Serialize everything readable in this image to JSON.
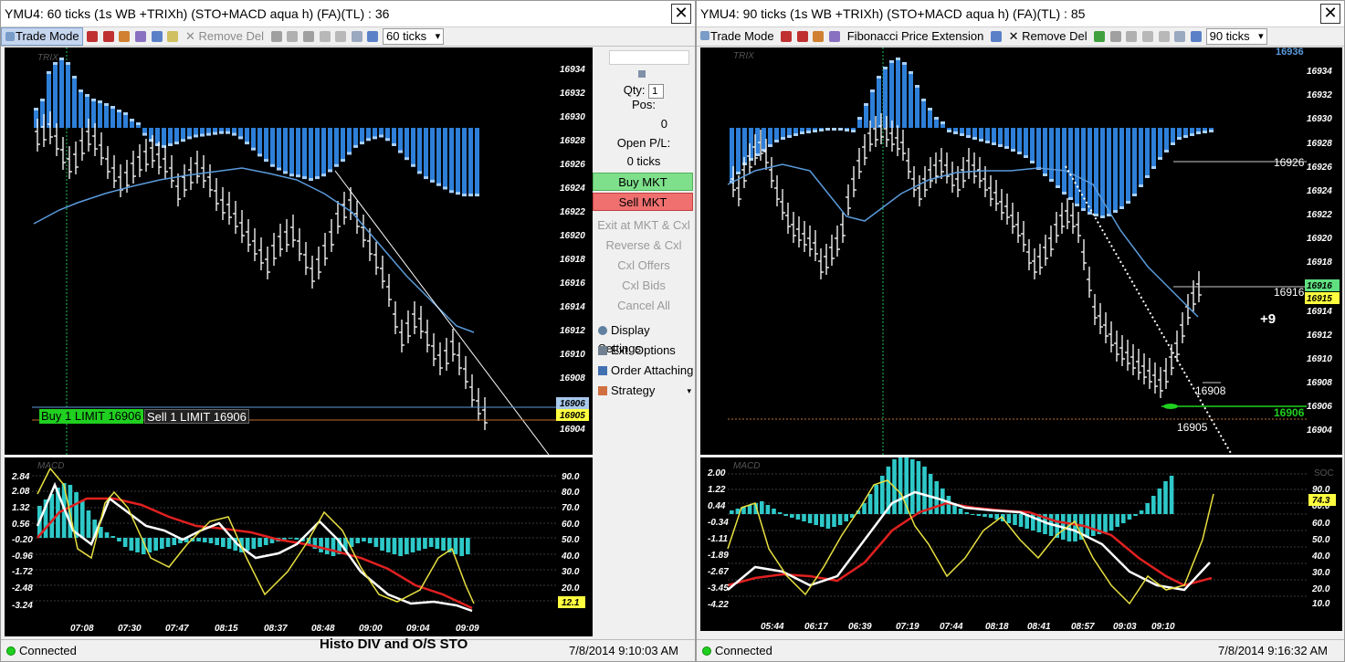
{
  "left_window": {
    "title": "YMU4: 60 ticks (1s WB +TRIXh) (STO+MACD aqua h) (FA)(TL) : 36",
    "close": "✕",
    "toolbar": {
      "trade_mode": "Trade Mode",
      "remove_del": "Remove Del",
      "interval": "60 ticks"
    },
    "price_chart": {
      "label": "TRIX",
      "axis": [
        "16934",
        "16932",
        "16930",
        "16928",
        "16926",
        "16924",
        "16922",
        "16920",
        "16918",
        "16916",
        "16914",
        "16912",
        "16910",
        "16908",
        "16906",
        "16905",
        "16904"
      ],
      "buy_order": "Buy 1 LIMIT 16906",
      "sell_order": "Sell 1 LIMIT 16906"
    },
    "macd_chart": {
      "label": "MACD",
      "left_axis": [
        "2.84",
        "2.08",
        "1.32",
        "0.56",
        "-0.20",
        "-0.96",
        "-1.72",
        "-2.48",
        "-3.24"
      ],
      "right_axis": [
        "90.0",
        "80.0",
        "70.0",
        "60.0",
        "50.0",
        "40.0",
        "30.0",
        "20.0",
        "12.1"
      ],
      "times": [
        "07:08",
        "07:30",
        "07:47",
        "08:15",
        "08:37",
        "08:48",
        "09:00",
        "09:04",
        "09:09"
      ]
    },
    "status": {
      "connected": "Connected",
      "time": "7/8/2014 9:10:03 AM"
    }
  },
  "order_panel": {
    "qty_label": "Qty:",
    "qty_value": "1",
    "pos_label": "Pos:",
    "pos_value": "0",
    "open_pl_label": "Open P/L:",
    "open_pl_value": "0 ticks",
    "buy_mkt": "Buy MKT",
    "sell_mkt": "Sell MKT",
    "exit": "Exit at MKT & Cxl",
    "reverse": "Reverse & Cxl",
    "cxl_offers": "Cxl Offers",
    "cxl_bids": "Cxl Bids",
    "cancel_all": "Cancel All",
    "display_settings": "Display Settings",
    "ext_options": "Ext. Options",
    "order_attaching": "Order Attaching",
    "strategy": "Strategy"
  },
  "caption": "Histo DIV and O/S STO",
  "right_window": {
    "title": "YMU4: 90 ticks (1s WB +TRIXh) (STO+MACD aqua h) (FA)(TL) : 85",
    "close": "✕",
    "toolbar": {
      "trade_mode": "Trade Mode",
      "fib": "Fibonacci Price Extension",
      "remove_del": "Remove Del",
      "interval": "90 ticks"
    },
    "price_chart": {
      "label": "TRIX",
      "axis": [
        "16936",
        "16934",
        "16932",
        "16930",
        "16928",
        "16926",
        "16924",
        "16922",
        "16920",
        "16918",
        "16916",
        "16915",
        "16914",
        "16912",
        "16910",
        "16908",
        "16906",
        "16904"
      ],
      "annotations": {
        "level_16926": "16926",
        "level_16916": "16916",
        "level_16906": "16906",
        "low_16908": "16908",
        "low_16905": "16905",
        "gain": "+9"
      }
    },
    "macd_chart": {
      "label": "MACD",
      "left_axis": [
        "2.00",
        "1.22",
        "0.44",
        "-0.34",
        "-1.11",
        "-1.89",
        "-2.67",
        "-3.45",
        "-4.22"
      ],
      "right_axis": [
        "90.0",
        "80.0",
        "74.3",
        "60.0",
        "50.0",
        "40.0",
        "30.0",
        "20.0",
        "10.0"
      ],
      "right_axis_top": "SOC",
      "times": [
        "05:44",
        "06:17",
        "06:39",
        "07:19",
        "07:44",
        "08:18",
        "08:41",
        "08:57",
        "09:03",
        "09:10"
      ]
    },
    "status": {
      "connected": "Connected",
      "time": "7/8/2014 9:16:32 AM"
    }
  },
  "colors": {
    "histogram": "#2e7fd8",
    "macd_histogram": "#2ec8c8",
    "trix_line": "#5a9bdc",
    "stoch_yellow": "#e8e040",
    "macd_red": "#e02020",
    "buy_green": "#20d020",
    "price_tag_yellow": "#ffff40"
  }
}
